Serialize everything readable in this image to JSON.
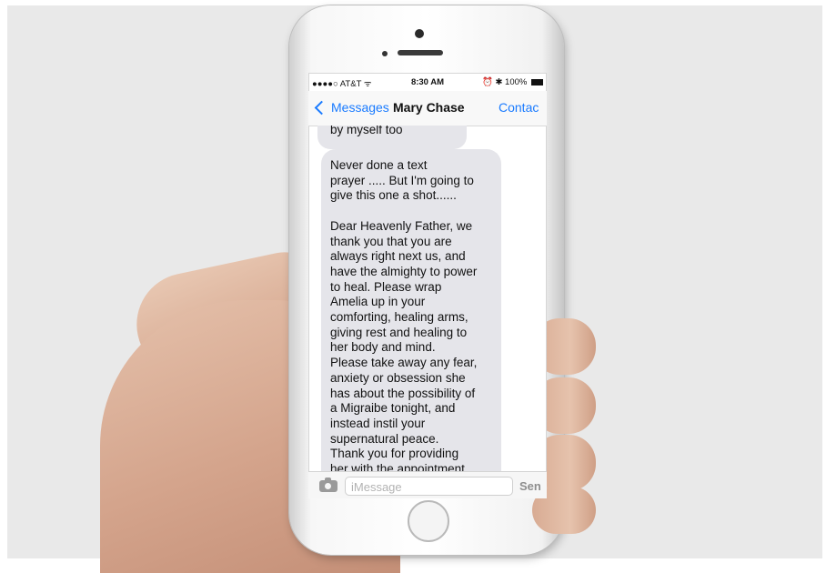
{
  "status_bar": {
    "carrier": "●●●●○ AT&T ᯤ",
    "time": "8:30 AM",
    "right": "⏰ ✱ 100%"
  },
  "nav": {
    "back_label": "Messages",
    "title": "Mary Chase",
    "contact_label": "Contac"
  },
  "thread": {
    "previous_bubble_tail": "by myself too",
    "message_lines": [
      "Never done a text",
      "prayer ..... But I'm going to",
      "give this one a shot......",
      "",
      "Dear Heavenly Father, we",
      "thank you that you are",
      "always right next us, and",
      "have the almighty to power",
      "to heal.  Please wrap",
      "Amelia up in your",
      "comforting, healing arms,",
      "giving rest and healing to",
      "her body and mind.",
      "Please take away any fear,",
      "anxiety or obsession she",
      "has about the possibility of",
      "a Migraibe tonight, and",
      "instead instil your",
      "supernatural peace.",
      "Thank you for providing",
      "her with the appointment"
    ]
  },
  "input_bar": {
    "placeholder": "iMessage",
    "send_label": "Sen"
  },
  "colors": {
    "accent": "#1a7bff",
    "bubble": "#e5e5ea"
  }
}
